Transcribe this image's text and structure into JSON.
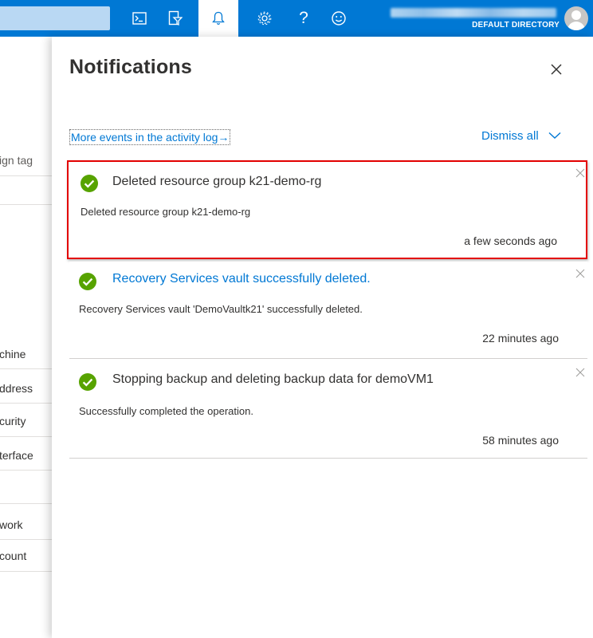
{
  "topbar": {
    "icons": [
      "cloud-shell-icon",
      "directory-filter-icon",
      "notifications-bell-icon",
      "settings-gear-icon",
      "help-icon",
      "feedback-smiley-icon"
    ],
    "help_glyph": "?",
    "directory_label": "DEFAULT DIRECTORY"
  },
  "background_blade": {
    "fragments": [
      "ign tag",
      "chine",
      "ddress",
      "curity",
      "terface",
      "work",
      "count"
    ]
  },
  "notifications": {
    "title": "Notifications",
    "activity_link": "More events in the activity log",
    "activity_arrow": "→",
    "dismiss_all": "Dismiss all",
    "items": [
      {
        "title": "Deleted resource group k21-demo-rg",
        "body": "Deleted resource group k21-demo-rg",
        "time": "a few seconds ago",
        "status": "success",
        "highlighted": true
      },
      {
        "title": "Recovery Services vault successfully deleted.",
        "body": "Recovery Services vault 'DemoVaultk21' successfully deleted.",
        "time": "22 minutes ago",
        "status": "success",
        "title_is_link": true
      },
      {
        "title": "Stopping backup and deleting backup data for demoVM1",
        "body": "Successfully completed the operation.",
        "time": "58 minutes ago",
        "status": "success"
      }
    ]
  },
  "colors": {
    "accent": "#0078d4",
    "success": "#57a300",
    "highlight_border": "#e30000"
  }
}
